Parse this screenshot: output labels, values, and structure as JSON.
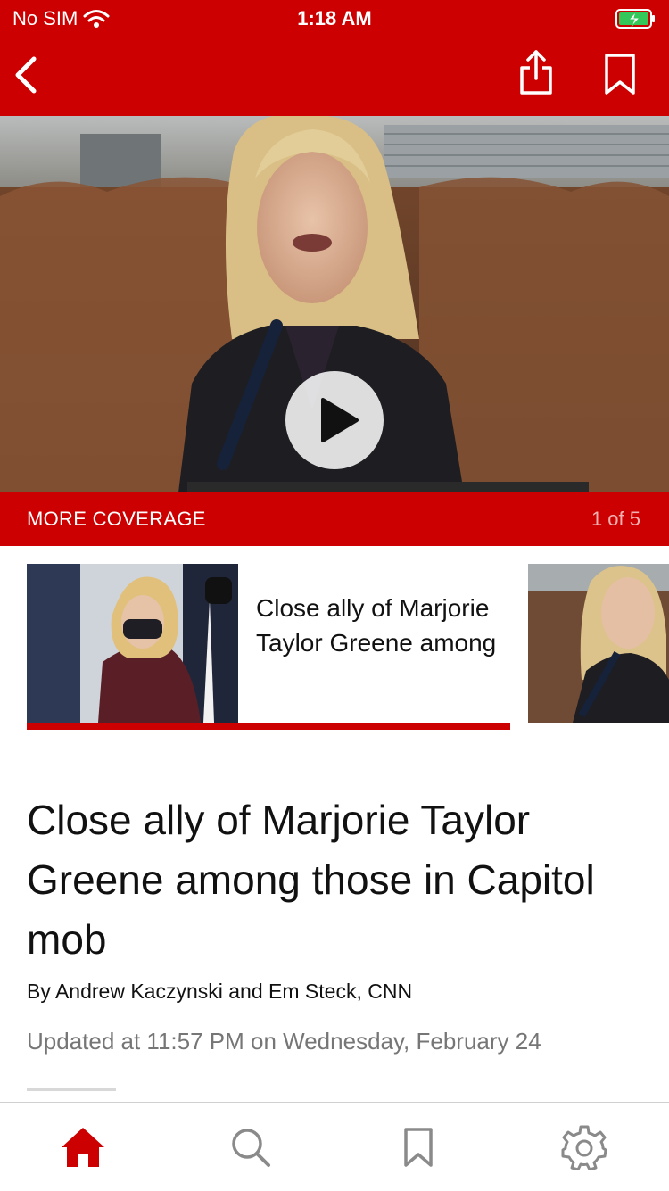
{
  "status_bar": {
    "carrier": "No SIM",
    "time": "1:18 AM"
  },
  "nav": {
    "back_icon": "chevron-left-icon",
    "share_icon": "share-icon",
    "bookmark_icon": "bookmark-icon"
  },
  "hero": {
    "media": "video",
    "play_icon": "play-icon"
  },
  "coverage": {
    "label": "MORE COVERAGE",
    "count": "1 of 5"
  },
  "cards": [
    {
      "title": "Close ally of Marjorie Taylor Greene among"
    }
  ],
  "article": {
    "headline": "Close ally of Marjorie Taylor Greene among those in Capitol mob",
    "byline": "By Andrew Kaczynski and Em Steck, CNN",
    "updated": "Updated at 11:57 PM on Wednesday, February 24"
  },
  "tabs": [
    "home-icon",
    "search-icon",
    "bookmark-icon",
    "gear-icon"
  ],
  "colors": {
    "brand_red": "#cc0000",
    "muted_text": "#767676",
    "icon_gray": "#8a8a8a"
  }
}
